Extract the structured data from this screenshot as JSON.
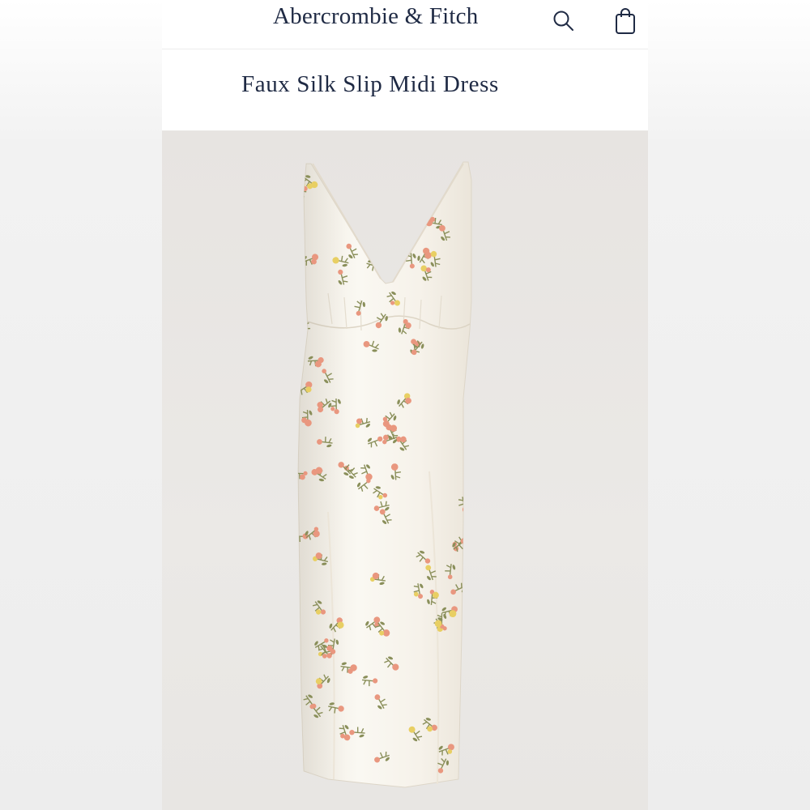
{
  "header": {
    "brand": "Abercrombie & Fitch",
    "icons": [
      "search-icon",
      "shopping-bag-icon"
    ]
  },
  "product": {
    "title": "Faux Silk Slip Midi Dress",
    "image": "white floral print faux silk slip midi dress"
  },
  "colors": {
    "brand_navy": "#1f2a44",
    "photo_bg": "#e9e7e4",
    "dress": "#f7f4ec",
    "flower_pink": "#e9977f",
    "flower_yellow": "#e8cf63",
    "leaf_green": "#8a8f5a"
  }
}
